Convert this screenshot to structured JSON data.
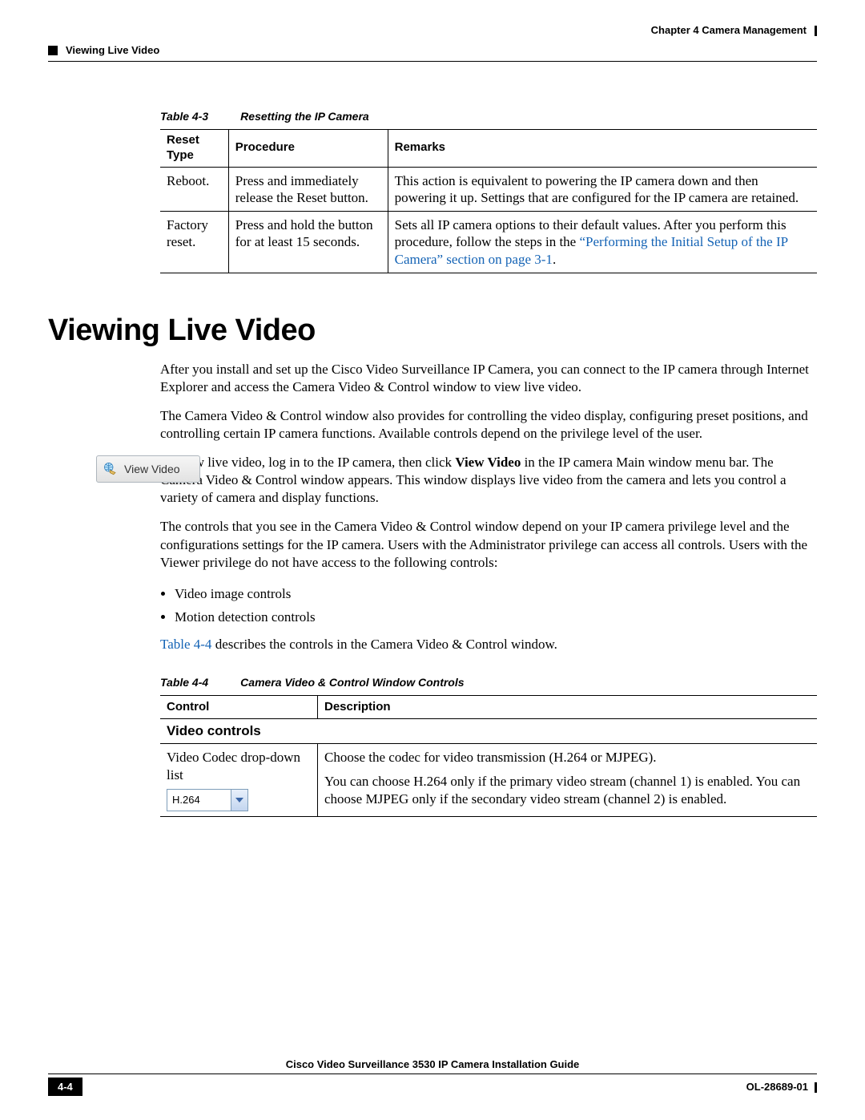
{
  "header": {
    "chapter": "Chapter 4      Camera Management",
    "section": "Viewing Live Video"
  },
  "table43": {
    "caption_num": "Table 4-3",
    "caption_title": "Resetting the IP Camera",
    "headers": [
      "Reset Type",
      "Procedure",
      "Remarks"
    ],
    "rows": [
      {
        "c1": "Reboot.",
        "c2": "Press and immediately release the Reset button.",
        "c3": "This action is equivalent to powering the IP camera down and then powering it up. Settings that are configured for the IP camera are retained."
      },
      {
        "c1": "Factory reset.",
        "c2": "Press and hold the button for at least 15 seconds.",
        "c3_pre": "Sets all IP camera options to their default values. After you perform this procedure, follow the steps in the ",
        "c3_link": "“Performing the Initial Setup of the IP Camera” section on page 3-1",
        "c3_post": "."
      }
    ]
  },
  "main": {
    "title": "Viewing Live Video",
    "p1": "After you install and set up the Cisco Video Surveillance IP Camera, you can connect to the IP camera through Internet Explorer and access the Camera Video & Control window to view live video.",
    "p2": "The Camera Video & Control window also provides for controlling the video display, configuring preset positions, and controlling certain IP camera functions. Available controls depend on the privilege level of the user.",
    "view_btn": "View Video",
    "p3_pre": "To view live video, log in to the IP camera, then click ",
    "p3_bold": "View Video",
    "p3_post": " in the IP camera Main window menu bar. The Camera Video & Control window appears. This window displays live video from the camera and lets you control a variety of camera and display functions.",
    "p4": "The controls that you see in the Camera Video & Control window depend on your IP camera privilege level and the configurations settings for the IP camera. Users with the Administrator privilege can access all controls. Users with the Viewer privilege do not have access to the following controls:",
    "bullets": [
      "Video image controls",
      "Motion detection controls"
    ],
    "p5_link": "Table 4-4",
    "p5_post": " describes the controls in the Camera Video & Control window."
  },
  "table44": {
    "caption_num": "Table 4-4",
    "caption_title": "Camera Video & Control Window Controls",
    "headers": [
      "Control",
      "Description"
    ],
    "section": "Video controls",
    "row1": {
      "control": "Video Codec drop-down list",
      "dd_value": "H.264",
      "desc_p1": "Choose the codec for video transmission (H.264 or MJPEG).",
      "desc_p2": "You can choose H.264 only if the primary video stream (channel 1) is enabled. You can choose MJPEG only if the secondary video stream (channel 2) is enabled."
    }
  },
  "footer": {
    "title": "Cisco Video Surveillance 3530 IP Camera Installation Guide",
    "page": "4-4",
    "doc": "OL-28689-01"
  }
}
